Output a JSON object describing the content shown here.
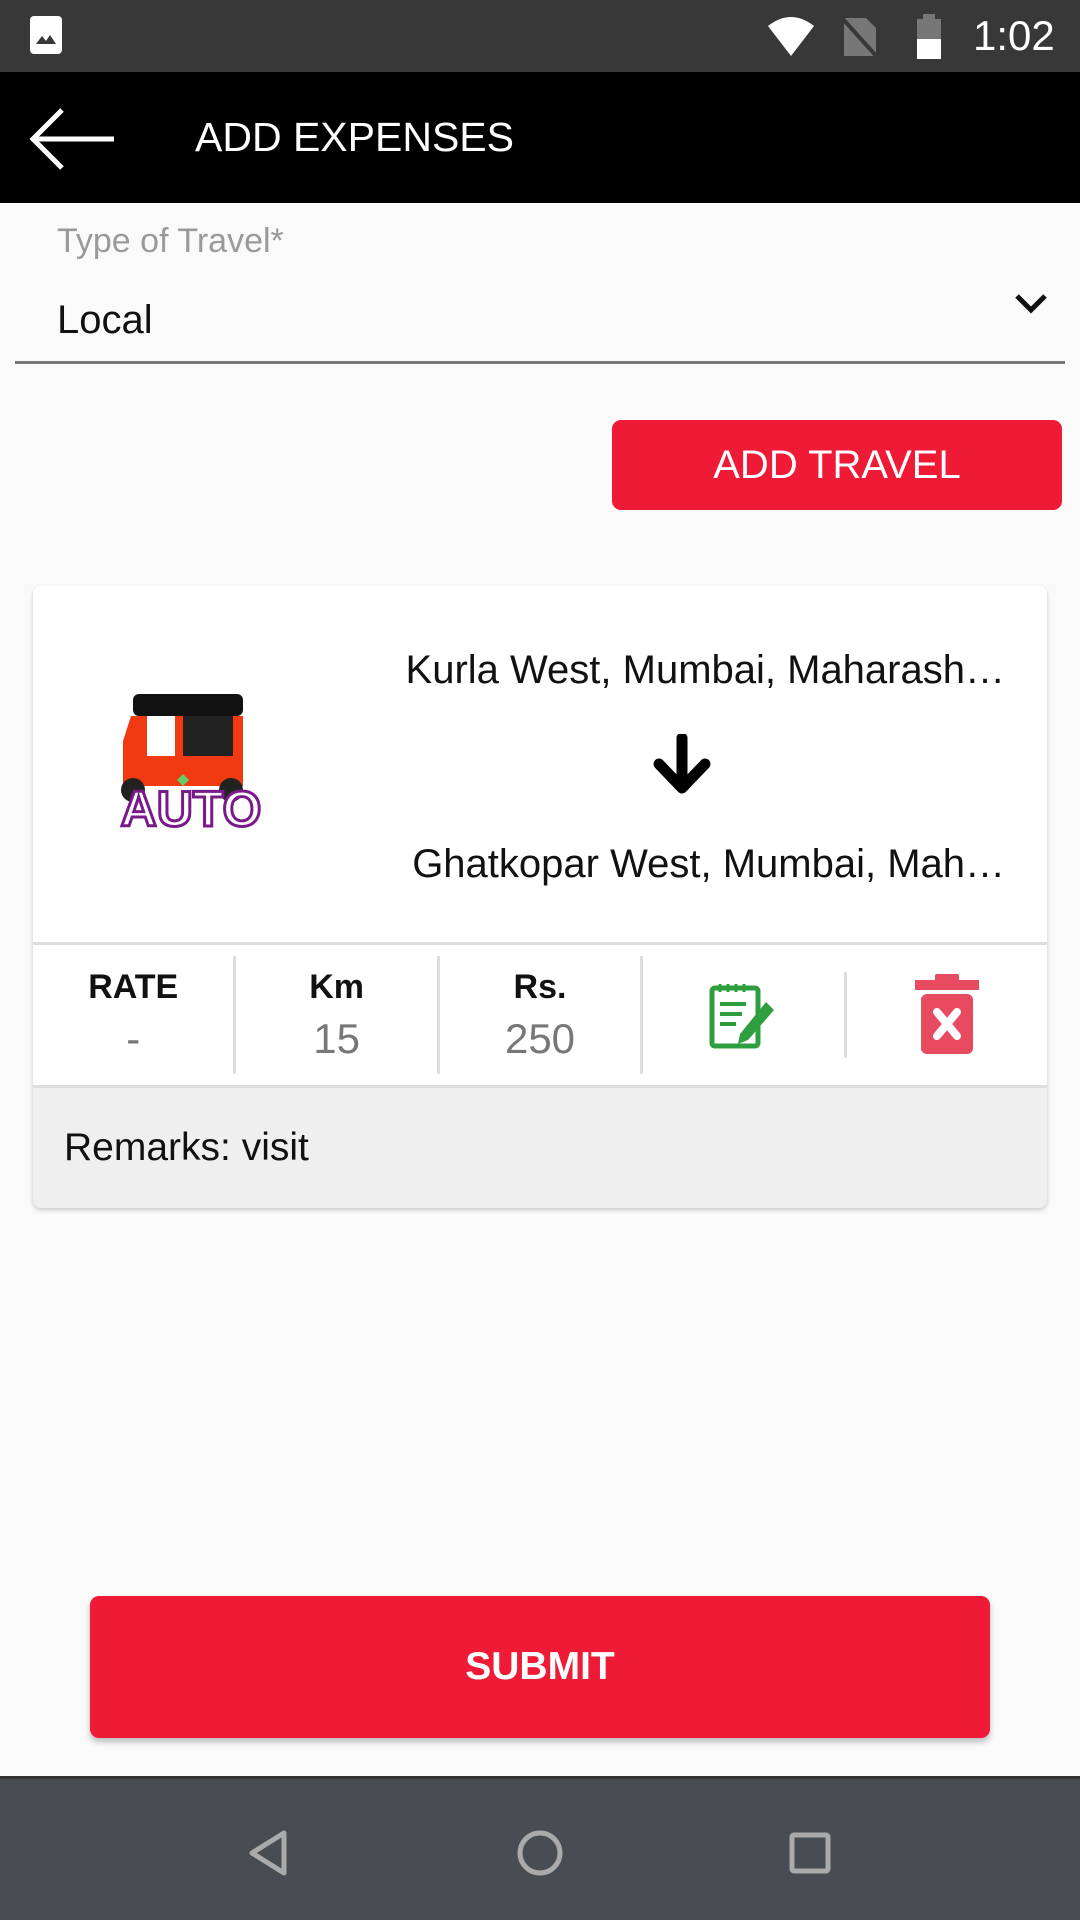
{
  "status_bar": {
    "time": "1:02",
    "icons": [
      "image-icon",
      "wifi-icon",
      "no-sim-icon",
      "battery-icon"
    ]
  },
  "app_bar": {
    "title": "ADD EXPENSES",
    "back_icon": "arrow-left-icon"
  },
  "travel_type": {
    "label": "Type of Travel*",
    "value": "Local"
  },
  "add_travel_label": "ADD TRAVEL",
  "travel_card": {
    "mode_image_text": "AUTO",
    "from": "Kurla West, Mumbai, Maharash…",
    "to": "Ghatkopar West, Mumbai, Mah…",
    "stats": [
      {
        "header": "RATE",
        "value": "-"
      },
      {
        "header": "Km",
        "value": "15"
      },
      {
        "header": "Rs.",
        "value": "250"
      }
    ],
    "remarks": "Remarks: visit"
  },
  "submit_label": "SUBMIT",
  "colors": {
    "accent": "#ee1a36",
    "edit": "#2e9e3e",
    "delete": "#e84a5f"
  }
}
